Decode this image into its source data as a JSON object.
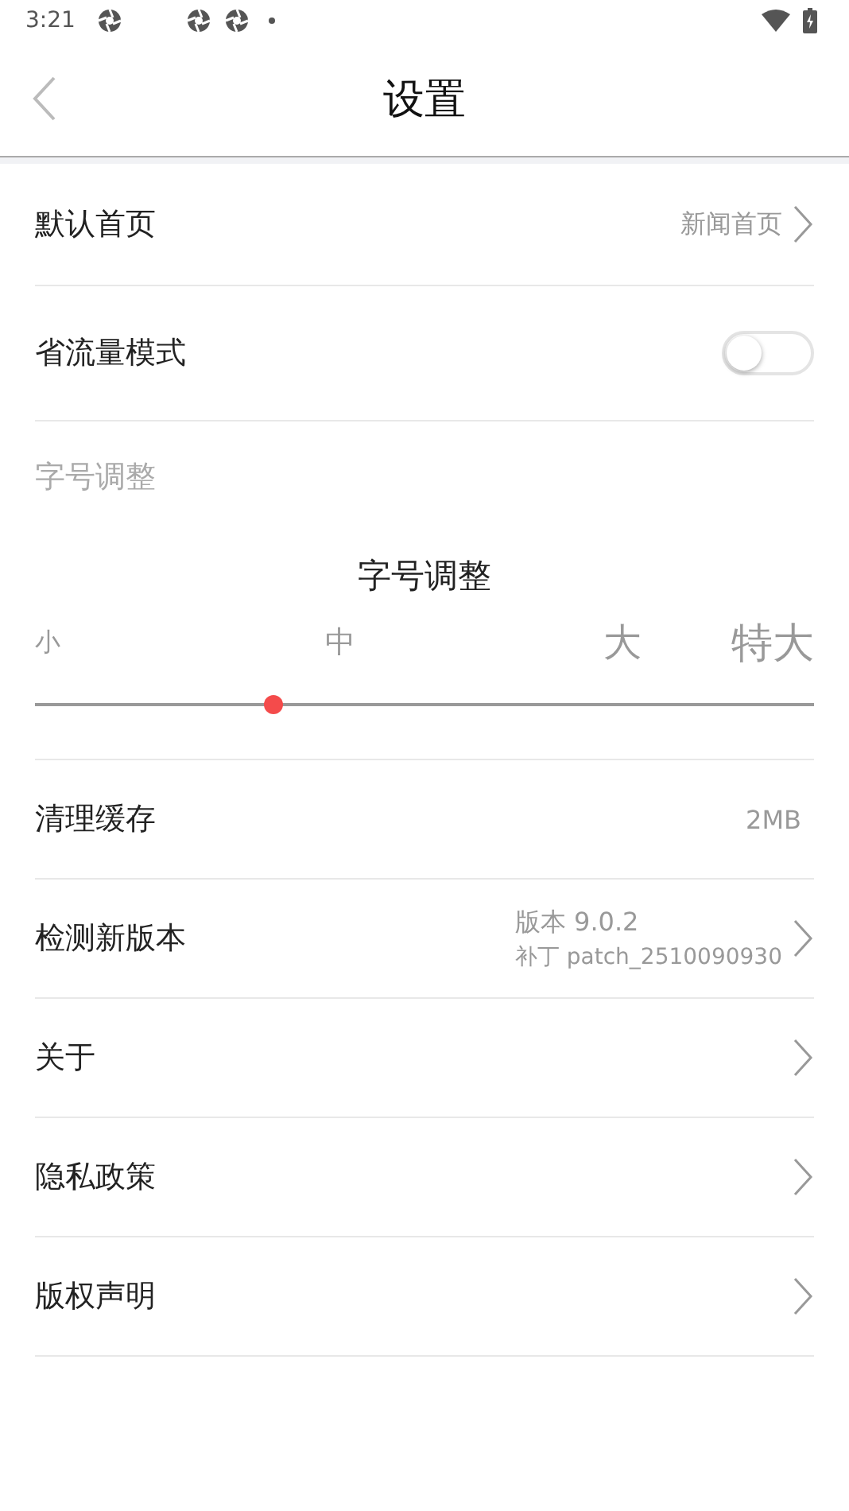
{
  "status_bar": {
    "time": "3:21"
  },
  "header": {
    "title": "设置"
  },
  "rows": [
    {
      "kind": "link",
      "label": "默认首页",
      "value": "新闻首页"
    },
    {
      "kind": "toggle",
      "label": "省流量模式",
      "on": false
    }
  ],
  "font_size": {
    "section_label": "字号调整",
    "title": "字号调整",
    "options": [
      "小",
      "中",
      "大",
      "特大"
    ],
    "level": 0.306
  },
  "rows_2": [
    {
      "kind": "value",
      "label": "清理缓存",
      "value": "2MB"
    },
    {
      "kind": "version",
      "label": "检测新版本",
      "value": "版本 9.0.2",
      "sub": "补丁 patch_2510090930"
    },
    {
      "kind": "link",
      "label": "关于"
    },
    {
      "kind": "link",
      "label": "隐私政策"
    },
    {
      "kind": "link",
      "label": "版权声明"
    }
  ]
}
